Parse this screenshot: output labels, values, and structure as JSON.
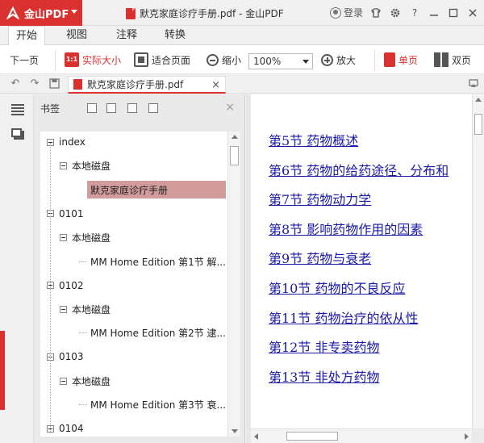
{
  "app": {
    "name": "金山PDF",
    "brand_color": "#d9312f"
  },
  "window": {
    "title": "默克家庭诊疗手册.pdf - 金山PDF",
    "login_label": "登录"
  },
  "menu": {
    "tabs": [
      "开始",
      "视图",
      "注释",
      "转换"
    ],
    "active": "开始"
  },
  "ribbon": {
    "prev_page": "下一页",
    "actual_size": "实际大小",
    "fit_page": "适合页面",
    "zoom_out": "缩小",
    "zoom_value": "100%",
    "zoom_in": "放大",
    "single_page": "单页",
    "double_page": "双页"
  },
  "doc_tab": {
    "filename": "默克家庭诊疗手册.pdf",
    "close": "×"
  },
  "bookmark_panel": {
    "title": "书签",
    "close": "×",
    "tree": [
      {
        "label": "index",
        "level": 0,
        "toggle": true
      },
      {
        "label": "本地磁盘",
        "level": 1,
        "toggle": true
      },
      {
        "label": "默克家庭诊疗手册",
        "level": 2,
        "toggle": false,
        "selected": true
      },
      {
        "label": "0101",
        "level": 0,
        "toggle": true
      },
      {
        "label": "本地磁盘",
        "level": 1,
        "toggle": true
      },
      {
        "label": "MM Home Edition 第1节 解...",
        "level": 2,
        "toggle": false
      },
      {
        "label": "0102",
        "level": 0,
        "toggle": true
      },
      {
        "label": "本地磁盘",
        "level": 1,
        "toggle": true
      },
      {
        "label": "MM Home Edition 第2节 逮...",
        "level": 2,
        "toggle": false
      },
      {
        "label": "0103",
        "level": 0,
        "toggle": true
      },
      {
        "label": "本地磁盘",
        "level": 1,
        "toggle": true
      },
      {
        "label": "MM Home Edition 第3节 衰...",
        "level": 2,
        "toggle": false
      },
      {
        "label": "0104",
        "level": 0,
        "toggle": true
      }
    ]
  },
  "document": {
    "toc_links": [
      "第5节  药物概述",
      "第6节  药物的给药途径、分布和",
      "第7节  药物动力学",
      "第8节  影响药物作用的因素",
      "第9节  药物与衰老",
      "第10节  药物的不良反应",
      "第11节  药物治疗的依从性",
      "第12节  非专卖药物",
      "第13节  非处方药物"
    ],
    "link_color": "#1a1aa6"
  }
}
